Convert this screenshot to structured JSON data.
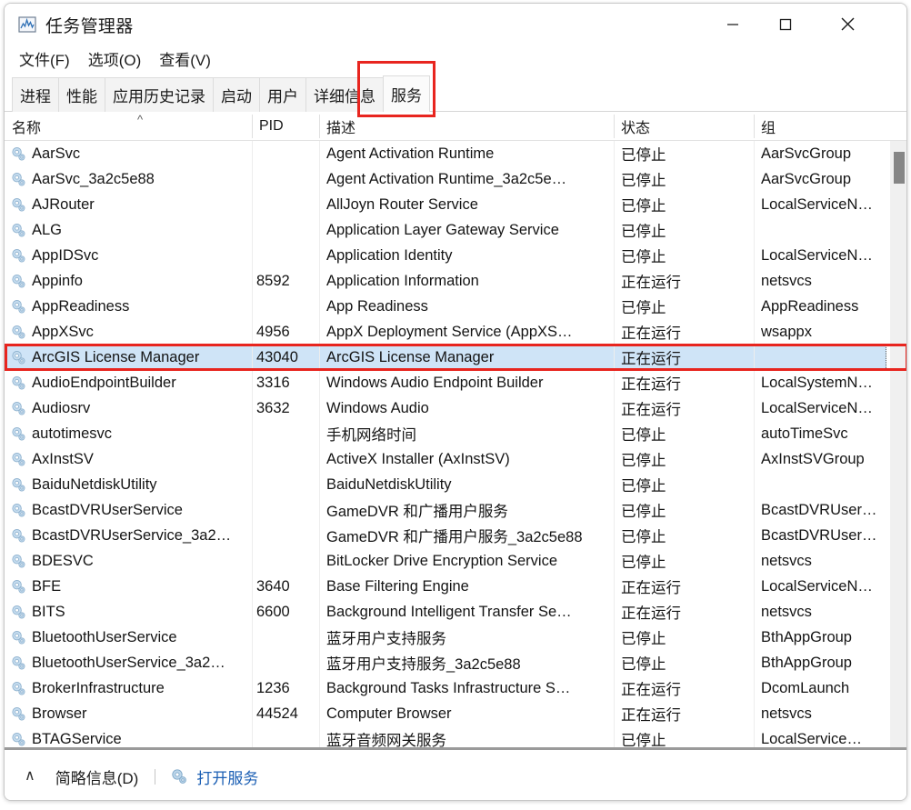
{
  "window": {
    "title": "任务管理器",
    "app_icon": "task-manager-chart-icon",
    "controls": {
      "minimize": "最小化",
      "maximize": "最大化",
      "close": "关闭"
    }
  },
  "menu": {
    "items": [
      {
        "label": "文件(F)"
      },
      {
        "label": "选项(O)"
      },
      {
        "label": "查看(V)"
      }
    ]
  },
  "tabs": {
    "items": [
      {
        "label": "进程",
        "active": false
      },
      {
        "label": "性能",
        "active": false
      },
      {
        "label": "应用历史记录",
        "active": false
      },
      {
        "label": "启动",
        "active": false
      },
      {
        "label": "用户",
        "active": false
      },
      {
        "label": "详细信息",
        "active": false
      },
      {
        "label": "服务",
        "active": true
      }
    ],
    "highlight_color": "#e8251f"
  },
  "table": {
    "columns": [
      {
        "key": "name",
        "label": "名称",
        "sorted": true,
        "sort_glyph": "^"
      },
      {
        "key": "pid",
        "label": "PID"
      },
      {
        "key": "desc",
        "label": "描述"
      },
      {
        "key": "status",
        "label": "状态"
      },
      {
        "key": "group",
        "label": "组"
      }
    ],
    "selection_color": "#cfe4f7",
    "rows": [
      {
        "name": "AarSvc",
        "pid": "",
        "desc": "Agent Activation Runtime",
        "status": "已停止",
        "group": "AarSvcGroup"
      },
      {
        "name": "AarSvc_3a2c5e88",
        "pid": "",
        "desc": "Agent Activation Runtime_3a2c5e…",
        "status": "已停止",
        "group": "AarSvcGroup"
      },
      {
        "name": "AJRouter",
        "pid": "",
        "desc": "AllJoyn Router Service",
        "status": "已停止",
        "group": "LocalServiceN…"
      },
      {
        "name": "ALG",
        "pid": "",
        "desc": "Application Layer Gateway Service",
        "status": "已停止",
        "group": ""
      },
      {
        "name": "AppIDSvc",
        "pid": "",
        "desc": "Application Identity",
        "status": "已停止",
        "group": "LocalServiceN…"
      },
      {
        "name": "Appinfo",
        "pid": "8592",
        "desc": "Application Information",
        "status": "正在运行",
        "group": "netsvcs"
      },
      {
        "name": "AppReadiness",
        "pid": "",
        "desc": "App Readiness",
        "status": "已停止",
        "group": "AppReadiness"
      },
      {
        "name": "AppXSvc",
        "pid": "4956",
        "desc": "AppX Deployment Service (AppXS…",
        "status": "正在运行",
        "group": "wsappx"
      },
      {
        "name": "ArcGIS License Manager",
        "pid": "43040",
        "desc": "ArcGIS License Manager",
        "status": "正在运行",
        "group": "",
        "selected": true
      },
      {
        "name": "AudioEndpointBuilder",
        "pid": "3316",
        "desc": "Windows Audio Endpoint Builder",
        "status": "正在运行",
        "group": "LocalSystemN…"
      },
      {
        "name": "Audiosrv",
        "pid": "3632",
        "desc": "Windows Audio",
        "status": "正在运行",
        "group": "LocalServiceN…"
      },
      {
        "name": "autotimesvc",
        "pid": "",
        "desc": "手机网络时间",
        "status": "已停止",
        "group": "autoTimeSvc"
      },
      {
        "name": "AxInstSV",
        "pid": "",
        "desc": "ActiveX Installer (AxInstSV)",
        "status": "已停止",
        "group": "AxInstSVGroup"
      },
      {
        "name": "BaiduNetdiskUtility",
        "pid": "",
        "desc": "BaiduNetdiskUtility",
        "status": "已停止",
        "group": ""
      },
      {
        "name": "BcastDVRUserService",
        "pid": "",
        "desc": "GameDVR 和广播用户服务",
        "status": "已停止",
        "group": "BcastDVRUser…"
      },
      {
        "name": "BcastDVRUserService_3a2…",
        "pid": "",
        "desc": "GameDVR 和广播用户服务_3a2c5e88",
        "status": "已停止",
        "group": "BcastDVRUser…"
      },
      {
        "name": "BDESVC",
        "pid": "",
        "desc": "BitLocker Drive Encryption Service",
        "status": "已停止",
        "group": "netsvcs"
      },
      {
        "name": "BFE",
        "pid": "3640",
        "desc": "Base Filtering Engine",
        "status": "正在运行",
        "group": "LocalServiceN…"
      },
      {
        "name": "BITS",
        "pid": "6600",
        "desc": "Background Intelligent Transfer Se…",
        "status": "正在运行",
        "group": "netsvcs"
      },
      {
        "name": "BluetoothUserService",
        "pid": "",
        "desc": "蓝牙用户支持服务",
        "status": "已停止",
        "group": "BthAppGroup"
      },
      {
        "name": "BluetoothUserService_3a2…",
        "pid": "",
        "desc": "蓝牙用户支持服务_3a2c5e88",
        "status": "已停止",
        "group": "BthAppGroup"
      },
      {
        "name": "BrokerInfrastructure",
        "pid": "1236",
        "desc": "Background Tasks Infrastructure S…",
        "status": "正在运行",
        "group": "DcomLaunch"
      },
      {
        "name": "Browser",
        "pid": "44524",
        "desc": "Computer Browser",
        "status": "正在运行",
        "group": "netsvcs"
      },
      {
        "name": "BTAGService",
        "pid": "",
        "desc": "蓝牙音频网关服务",
        "status": "已停止",
        "group": "LocalService…"
      }
    ]
  },
  "statusbar": {
    "collapse_glyph": "∧",
    "brief_label": "简略信息(D)",
    "open_services_icon": "services-gear-icon",
    "open_services_label": "打开服务"
  }
}
